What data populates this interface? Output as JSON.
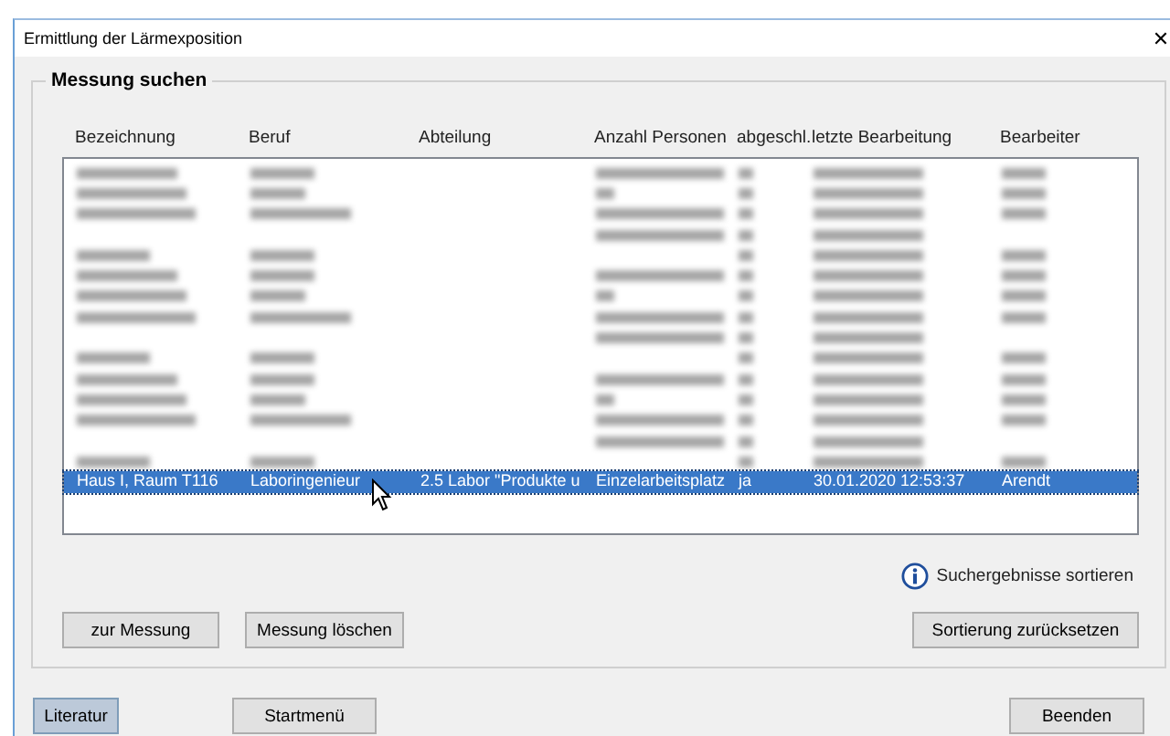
{
  "window": {
    "title": "Ermittlung der Lärmexposition",
    "close": "✕"
  },
  "group": {
    "title": "Messung suchen"
  },
  "table": {
    "columns": [
      "Bezeichnung",
      "Beruf",
      "Abteilung",
      "Anzahl Personen",
      "abgeschl.",
      "letzte Bearbeitung",
      "Bearbeiter"
    ],
    "rows": [
      {
        "kind": "blurred",
        "selected": false
      },
      {
        "kind": "blurred",
        "selected": false
      },
      {
        "kind": "blurred",
        "selected": false
      },
      {
        "kind": "blurred",
        "selected": false
      },
      {
        "kind": "blurred",
        "selected": false
      },
      {
        "kind": "blurred",
        "selected": false
      },
      {
        "kind": "blurred",
        "selected": false
      },
      {
        "kind": "blurred",
        "selected": false
      },
      {
        "kind": "blurred",
        "selected": false
      },
      {
        "kind": "blurred",
        "selected": false
      },
      {
        "kind": "blurred",
        "selected": false
      },
      {
        "kind": "blurred",
        "selected": false
      },
      {
        "kind": "blurred",
        "selected": false
      },
      {
        "kind": "blurred",
        "selected": false
      },
      {
        "kind": "blurred",
        "selected": false
      },
      {
        "kind": "text",
        "selected": true,
        "cells": [
          "Haus I, Raum T116",
          "Laboringenieur",
          "2.5 Labor \"Produkte u",
          "Einzelarbeitsplatz",
          "ja",
          "30.01.2020 12:53:37",
          "Arendt"
        ]
      }
    ]
  },
  "sort_hint": "Suchergebnisse sortieren",
  "actions": [
    {
      "label": "zur Messung",
      "focused": false
    },
    {
      "label": "Messung löschen",
      "focused": false
    }
  ],
  "reset_button": {
    "label": "Sortierung zurücksetzen",
    "focused": false
  },
  "footer": [
    {
      "label": "Literatur",
      "focused": true
    },
    {
      "label": "Startmenü",
      "focused": false
    },
    {
      "label": "Beenden",
      "focused": false
    }
  ]
}
